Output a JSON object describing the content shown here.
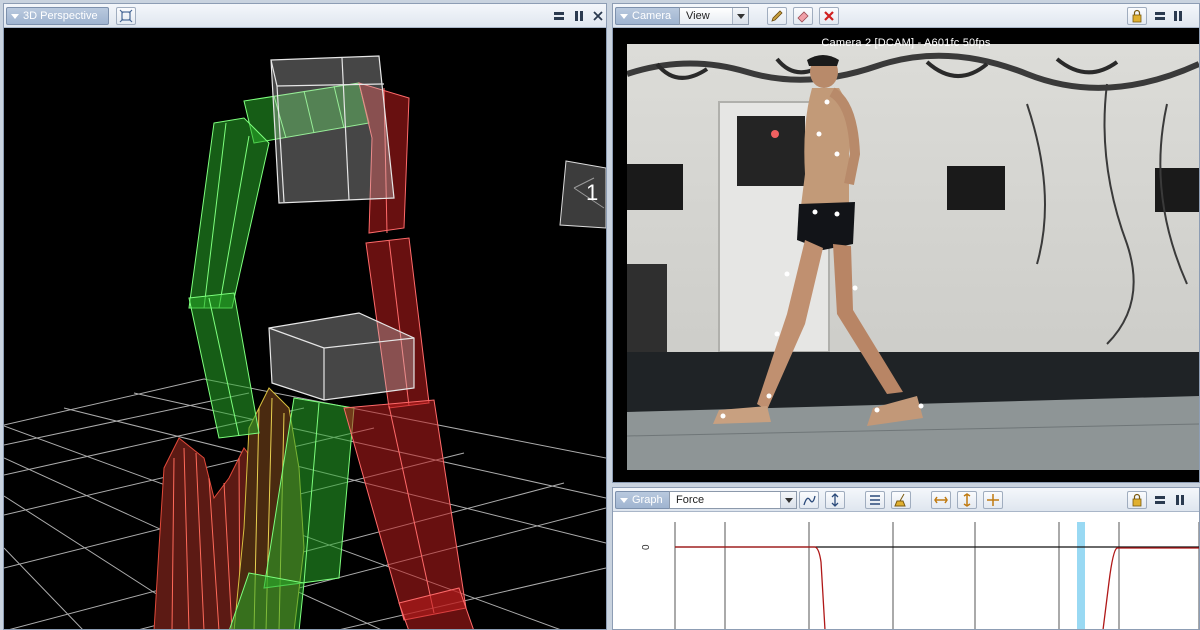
{
  "perspective": {
    "tab_label": "3D Perspective",
    "viewport_marker": "1"
  },
  "camera": {
    "tab_label": "Camera",
    "view_menu_label": "View",
    "video_title": "Camera 2 [DCAM] - A601fc 50fps"
  },
  "graph": {
    "tab_label": "Graph",
    "channel_select_value": "Force",
    "y_tick_label": "0"
  },
  "colors": {
    "accent": "#9fb4d0",
    "segment_left": "#2fd12f",
    "segment_right": "#e02a2a",
    "graph_line": "#b01818",
    "cursor": "#7fd0f0"
  },
  "icons": [
    "restore-view-icon",
    "pencil-icon",
    "eraser-icon",
    "close-x-icon",
    "lock-icon",
    "maximize-icon",
    "pause-icon",
    "close-icon",
    "curve-icon",
    "pin-icon",
    "list-icon",
    "broom-icon",
    "pan-h-icon",
    "pan-v-icon",
    "move-icon"
  ]
}
